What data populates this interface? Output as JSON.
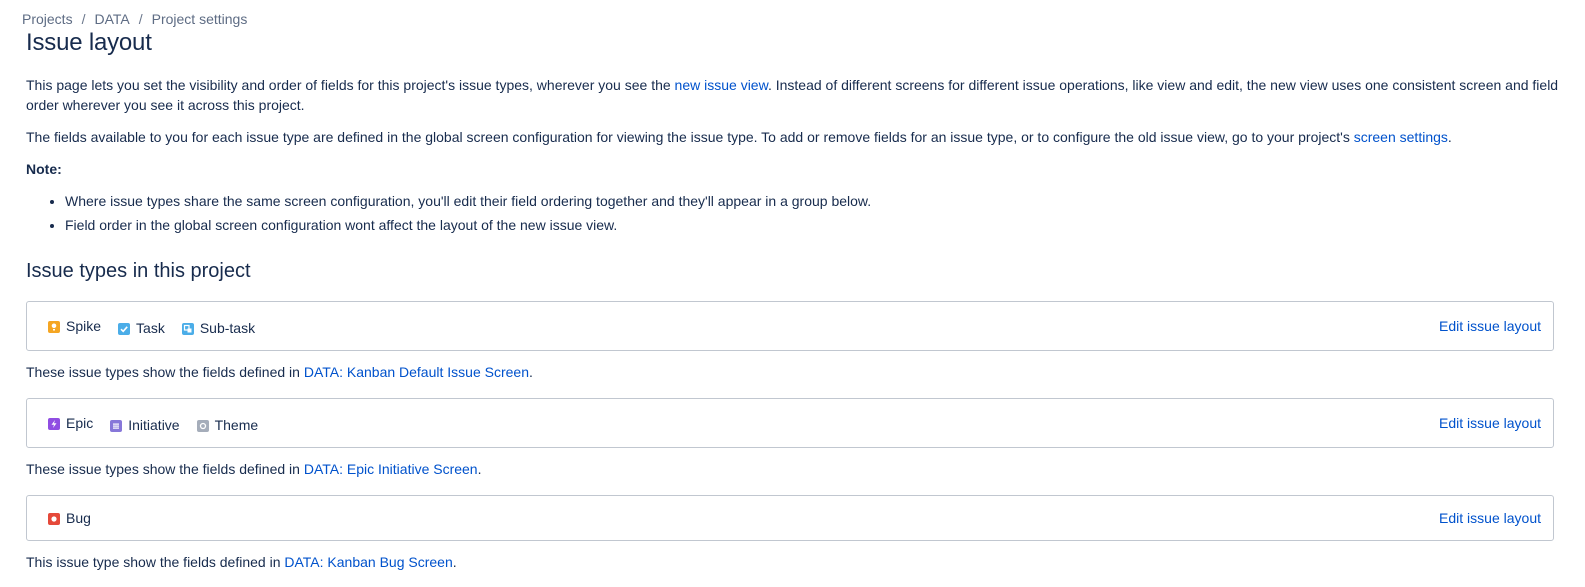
{
  "breadcrumb": {
    "items": [
      "Projects",
      "DATA",
      "Project settings"
    ],
    "separator": "/"
  },
  "page_title": "Issue layout",
  "intro": {
    "part1": "This page lets you set the visibility and order of fields for this project's issue types, wherever you see the ",
    "link": "new issue view",
    "part2": ". Instead of different screens for different issue operations, like view and edit, the new view uses one consistent screen and field order wherever you see it across this project."
  },
  "fields_info": {
    "part1": "The fields available to you for each issue type are defined in the global screen configuration for viewing the issue type. To add or remove fields for an issue type, or to configure the old issue view, go to your project's ",
    "link": "screen settings",
    "part2": "."
  },
  "note": {
    "label": "Note:",
    "items": [
      "Where issue types share the same screen configuration, you'll edit their field ordering together and they'll appear in a group below.",
      "Field order in the global screen configuration wont affect the layout of the new issue view."
    ]
  },
  "section_title": "Issue types in this project",
  "groups": [
    {
      "types": [
        {
          "name": "Spike",
          "icon": "spike-icon",
          "color": "#f5a623"
        },
        {
          "name": "Task",
          "icon": "task-icon",
          "color": "#4bade8"
        },
        {
          "name": "Sub-task",
          "icon": "subtask-icon",
          "color": "#4bade8"
        }
      ],
      "edit_label": "Edit issue layout",
      "caption_prefix": "These issue types show the fields defined in ",
      "caption_link": "DATA: Kanban Default Issue Screen",
      "caption_suffix": "."
    },
    {
      "types": [
        {
          "name": "Epic",
          "icon": "epic-icon",
          "color": "#904ee2"
        },
        {
          "name": "Initiative",
          "icon": "initiative-icon",
          "color": "#8777d9"
        },
        {
          "name": "Theme",
          "icon": "theme-icon",
          "color": "#a5adba"
        }
      ],
      "edit_label": "Edit issue layout",
      "caption_prefix": "These issue types show the fields defined in ",
      "caption_link": "DATA: Epic Initiative Screen",
      "caption_suffix": "."
    },
    {
      "types": [
        {
          "name": "Bug",
          "icon": "bug-icon",
          "color": "#e5493a"
        }
      ],
      "edit_label": "Edit issue layout",
      "caption_prefix": "This issue type show the fields defined in ",
      "caption_link": "DATA: Kanban Bug Screen",
      "caption_suffix": "."
    }
  ]
}
